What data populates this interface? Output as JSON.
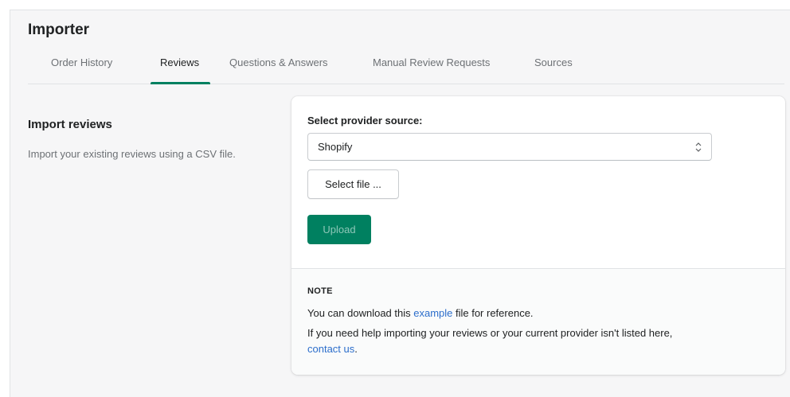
{
  "page": {
    "title": "Importer"
  },
  "tabs": [
    {
      "label": "Order History",
      "active": false
    },
    {
      "label": "Reviews",
      "active": true
    },
    {
      "label": "Questions & Answers",
      "active": false
    },
    {
      "label": "Manual Review Requests",
      "active": false
    },
    {
      "label": "Sources",
      "active": false
    }
  ],
  "section": {
    "title": "Import reviews",
    "description": "Import your existing reviews using a CSV file."
  },
  "form": {
    "provider_label": "Select provider source:",
    "provider_value": "Shopify",
    "select_file_label": "Select file ...",
    "upload_label": "Upload"
  },
  "note": {
    "heading": "NOTE",
    "line1_before": "You can download this ",
    "line1_link": "example",
    "line1_after": " file for reference.",
    "line2": "If you need help importing your reviews or your current provider isn't listed here,",
    "line3_link": "contact us",
    "line3_after": "."
  },
  "colors": {
    "accent": "#008060",
    "link": "#2c6ecb",
    "background": "#f6f6f7"
  },
  "icons": {
    "select_arrow": "select-arrows-icon"
  }
}
